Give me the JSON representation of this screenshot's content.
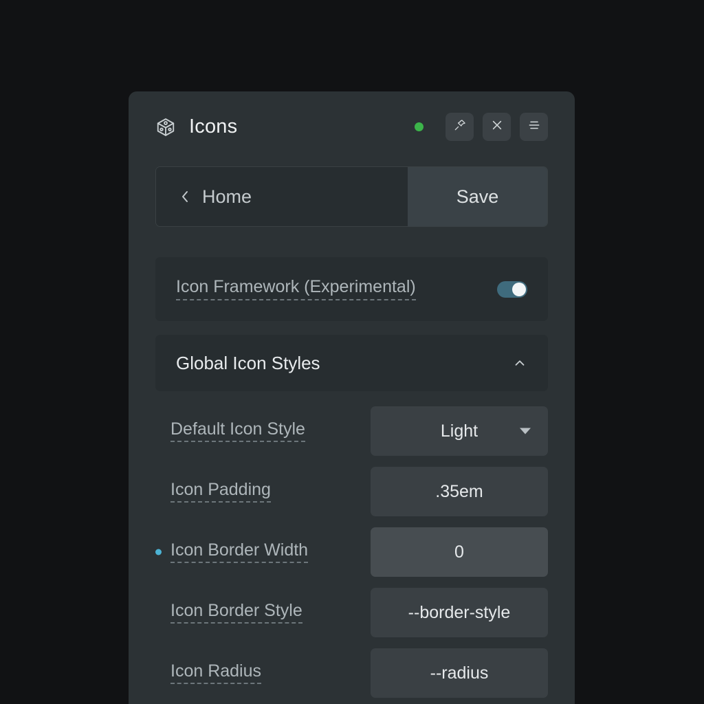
{
  "window": {
    "background_color": "#111214",
    "panel_color": "#2c3235"
  },
  "header": {
    "app_icon": "cube-icon",
    "title": "Icons",
    "status_dot": {
      "name": "status-dot",
      "color": "#3cb44a"
    },
    "buttons": [
      {
        "name": "pin-button",
        "icon": "pin-icon"
      },
      {
        "name": "close-button",
        "icon": "close-x-icon"
      },
      {
        "name": "menu-button",
        "icon": "hamburger-menu-icon"
      }
    ]
  },
  "navbar": {
    "back_icon": "chevron-left-icon",
    "home_label": "Home",
    "save_label": "Save"
  },
  "feature_toggle": {
    "label": "Icon Framework (Experimental)",
    "enabled": true,
    "accent_color": "#3f6b7d"
  },
  "section": {
    "title": "Global Icon Styles",
    "expanded": true,
    "collapse_icon": "chevron-up-icon"
  },
  "settings": {
    "rows": [
      {
        "label": "Default Icon Style",
        "value": "Light",
        "control": "dropdown",
        "marker": false,
        "highlighted": false
      },
      {
        "label": "Icon Padding",
        "value": ".35em",
        "control": "text",
        "marker": false,
        "highlighted": false
      },
      {
        "label": "Icon Border Width",
        "value": "0",
        "control": "text",
        "marker": true,
        "marker_color": "#4cb3d4",
        "highlighted": true
      },
      {
        "label": "Icon Border Style",
        "value": "--border-style",
        "control": "text",
        "marker": false,
        "highlighted": false
      },
      {
        "label": "Icon Radius",
        "value": "--radius",
        "control": "text",
        "marker": false,
        "highlighted": false
      }
    ]
  }
}
